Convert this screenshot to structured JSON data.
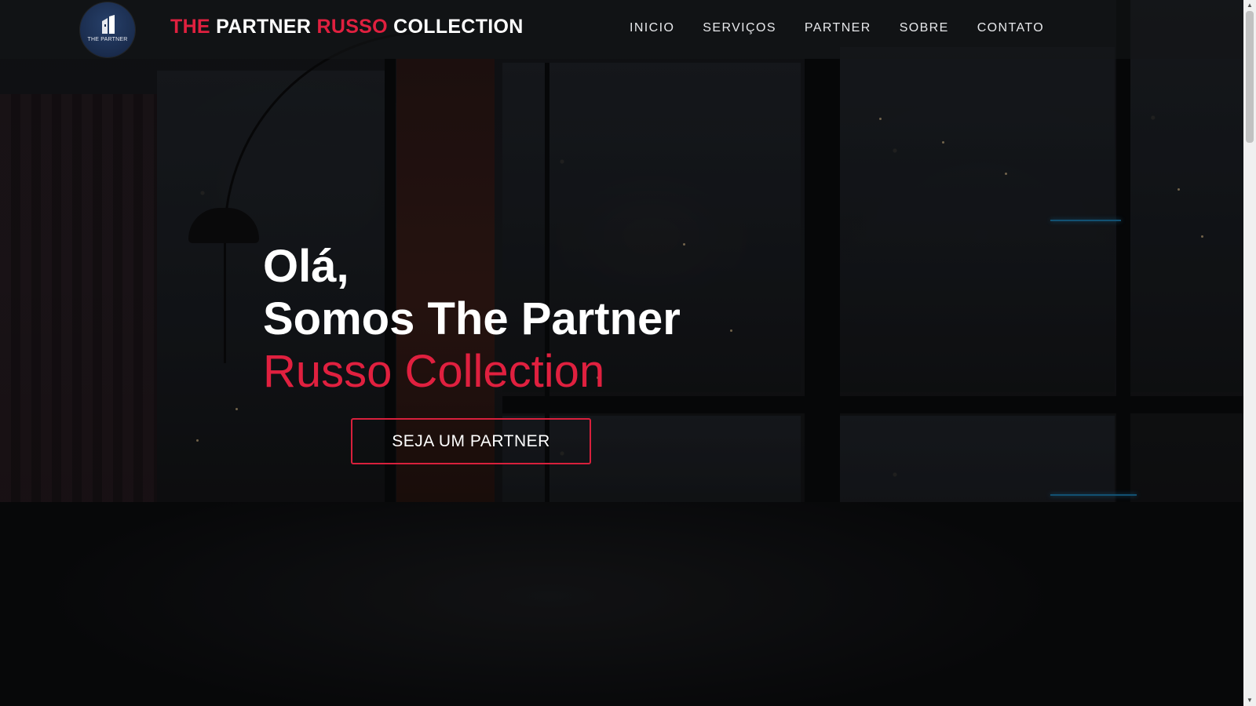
{
  "header": {
    "logo_text": "THE PARTNER",
    "brand": {
      "part1": "THE",
      "part2": "PARTNER",
      "part3": "RUSSO",
      "part4": "COLLECTION"
    },
    "nav": [
      {
        "label": "INICIO"
      },
      {
        "label": "SERVIÇOS"
      },
      {
        "label": "PARTNER"
      },
      {
        "label": "SOBRE"
      },
      {
        "label": "CONTATO"
      }
    ]
  },
  "hero": {
    "line1": "Olá,",
    "line2": "Somos The Partner",
    "line3": "Russo Collection",
    "cta_label": "SEJA UM PARTNER"
  },
  "colors": {
    "accent": "#e0203f",
    "text": "#ffffff",
    "logo_bg": "#1a2c4d"
  },
  "scrollbar": {
    "up_icon": "arrow-up-icon",
    "down_icon": "arrow-down-icon"
  }
}
